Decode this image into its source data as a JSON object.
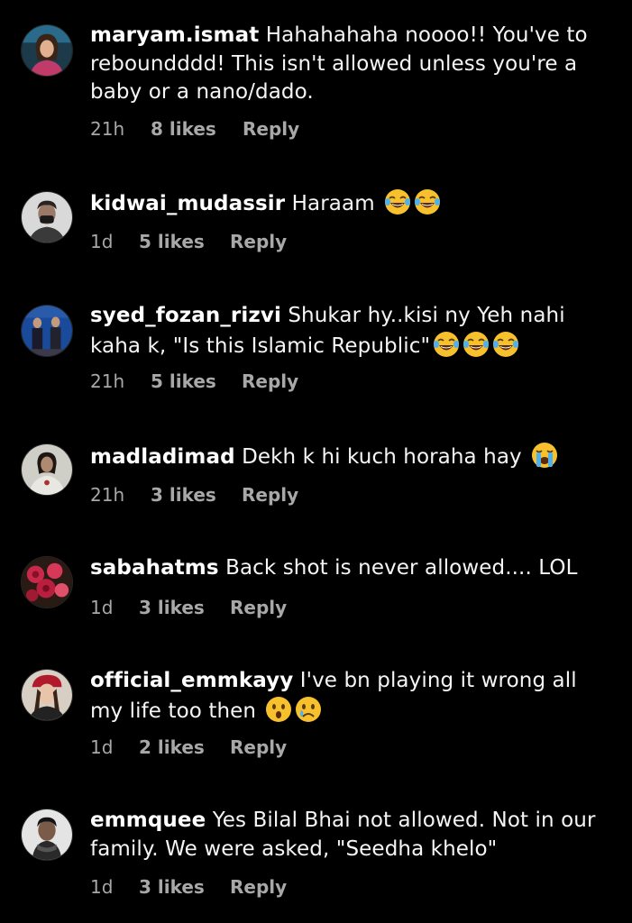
{
  "comments": [
    {
      "username": "maryam.ismat",
      "text": "Hahahahaha noooo!! You've to reboundddd! This isn't allowed unless you're a baby or a nano/dado.",
      "time": "21h",
      "likes": "8 likes",
      "reply": "Reply",
      "emojis": []
    },
    {
      "username": "kidwai_mudassir",
      "text": "Haraam",
      "time": "1d",
      "likes": "5 likes",
      "reply": "Reply",
      "emojis": [
        "face-with-tears-of-joy",
        "face-with-tears-of-joy"
      ]
    },
    {
      "username": "syed_fozan_rizvi",
      "text": "Shukar hy..kisi ny Yeh nahi kaha k, \"Is this Islamic Republic\"",
      "time": "21h",
      "likes": "5 likes",
      "reply": "Reply",
      "emojis": [
        "face-with-tears-of-joy",
        "face-with-tears-of-joy",
        "face-with-tears-of-joy"
      ]
    },
    {
      "username": "madladimad",
      "text": "Dekh k hi kuch horaha hay",
      "time": "21h",
      "likes": "3 likes",
      "reply": "Reply",
      "emojis": [
        "loudly-crying-face"
      ]
    },
    {
      "username": "sabahatms",
      "text": "Back shot is never allowed.... LOL",
      "time": "1d",
      "likes": "3 likes",
      "reply": "Reply",
      "emojis": []
    },
    {
      "username": "official_emmkayy",
      "text": "I've bn playing it wrong all my life too then",
      "time": "1d",
      "likes": "2 likes",
      "reply": "Reply",
      "emojis": [
        "hushed-face",
        "crying-face"
      ]
    },
    {
      "username": "emmquee",
      "text": "Yes Bilal Bhai not allowed. Not in our family. We were asked, \"Seedha khelo\"",
      "time": "1d",
      "likes": "3 likes",
      "reply": "Reply",
      "emojis": []
    }
  ],
  "colors": {
    "background": "#000000",
    "text": "#f5f5f5",
    "meta": "#a8a8a8"
  }
}
